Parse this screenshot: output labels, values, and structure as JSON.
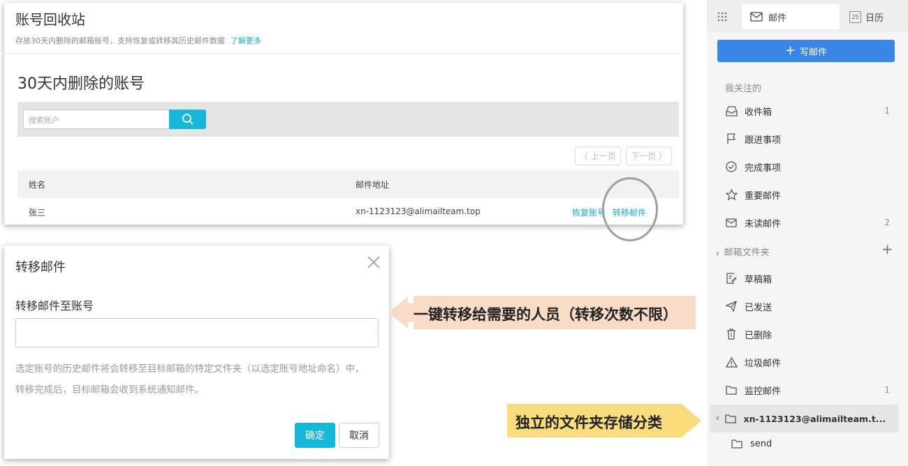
{
  "recycle": {
    "title": "账号回收站",
    "description": "存放30天内删除的邮箱账号，支持恢复或转移其历史邮件数据",
    "learn_more": "了解更多",
    "section_title": "30天内删除的账号",
    "search_placeholder": "搜索账户",
    "prev_label": "〈 上一页",
    "next_label": "下一页 〉",
    "columns": {
      "name": "姓名",
      "address": "邮件地址"
    },
    "rows": [
      {
        "name": "张三",
        "address": "xn-1123123@alimailteam.top",
        "restore": "恢复账号",
        "transfer": "转移邮件"
      }
    ]
  },
  "dialog": {
    "title": "转移邮件",
    "field_label": "转移邮件至账号",
    "input_value": "",
    "note_line1": "选定账号的历史邮件将会转移至目标邮箱的特定文件夹（以选定账号地址命名）中，",
    "note_line2": "转移完成后，目标邮箱会收到系统通知邮件。",
    "ok": "确定",
    "cancel": "取消"
  },
  "callouts": {
    "transfer": "一键转移给需要的人员（转移次数不限）",
    "folder": "独立的文件夹存储分类"
  },
  "sidebar": {
    "nav": {
      "mail": "邮件",
      "calendar": "日历",
      "calendar_day": "25"
    },
    "compose": "写邮件",
    "favorites_title": "我关注的",
    "favorites": [
      {
        "label": "收件箱",
        "icon": "inbox-icon",
        "count": "1"
      },
      {
        "label": "跟进事项",
        "icon": "flag-icon",
        "count": ""
      },
      {
        "label": "完成事项",
        "icon": "check-circle-icon",
        "count": ""
      },
      {
        "label": "重要邮件",
        "icon": "star-icon",
        "count": ""
      },
      {
        "label": "未读邮件",
        "icon": "envelope-icon",
        "count": "2"
      }
    ],
    "folders_title": "邮箱文件夹",
    "folders": [
      {
        "label": "草稿箱",
        "icon": "draft-icon",
        "count": ""
      },
      {
        "label": "已发送",
        "icon": "send-icon",
        "count": ""
      },
      {
        "label": "已删除",
        "icon": "trash-icon",
        "count": ""
      },
      {
        "label": "垃圾邮件",
        "icon": "warning-icon",
        "count": ""
      },
      {
        "label": "监控邮件",
        "icon": "folder-icon",
        "count": "1"
      }
    ],
    "account_folder": "xn-1123123@alimailteam.t...",
    "sub_folder": "send"
  },
  "colors": {
    "accent": "#16b7d9",
    "compose_blue": "#3a86e6",
    "callout_orange": "#f8dcc8",
    "callout_yellow": "#f9dc7c"
  }
}
